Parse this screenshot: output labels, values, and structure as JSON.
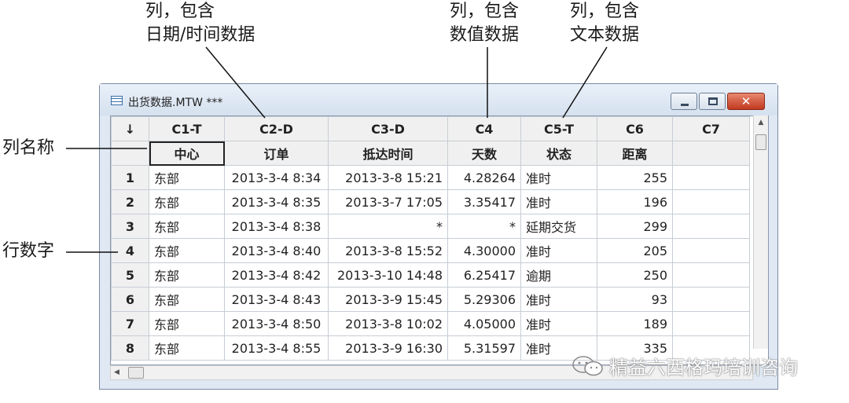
{
  "annotations": {
    "date_col_line1": "列，包含",
    "date_col_line2": "日期/时间数据",
    "num_col_line1": "列，包含",
    "num_col_line2": "数值数据",
    "text_col_line1": "列，包含",
    "text_col_line2": "文本数据",
    "col_name": "列名称",
    "row_number": "行数字"
  },
  "window": {
    "title": "出货数据.MTW ***",
    "close_glyph": "✕"
  },
  "sheet": {
    "corner": "↓",
    "headers": [
      "C1-T",
      "C2-D",
      "C3-D",
      "C4",
      "C5-T",
      "C6",
      "C7"
    ],
    "names": [
      "中心",
      "订单",
      "抵达时间",
      "天数",
      "状态",
      "距离",
      ""
    ],
    "rows": [
      {
        "n": "1",
        "c1": "东部",
        "c2": "2013-3-4 8:34",
        "c3": "2013-3-8 15:21",
        "c4": "4.28264",
        "c5": "准时",
        "c6": "255",
        "c7": ""
      },
      {
        "n": "2",
        "c1": "东部",
        "c2": "2013-3-4 8:35",
        "c3": "2013-3-7 17:05",
        "c4": "3.35417",
        "c5": "准时",
        "c6": "196",
        "c7": ""
      },
      {
        "n": "3",
        "c1": "东部",
        "c2": "2013-3-4 8:38",
        "c3": "*",
        "c4": "*",
        "c5": "延期交货",
        "c6": "299",
        "c7": ""
      },
      {
        "n": "4",
        "c1": "东部",
        "c2": "2013-3-4 8:40",
        "c3": "2013-3-8 15:52",
        "c4": "4.30000",
        "c5": "准时",
        "c6": "205",
        "c7": ""
      },
      {
        "n": "5",
        "c1": "东部",
        "c2": "2013-3-4 8:42",
        "c3": "2013-3-10 14:48",
        "c4": "6.25417",
        "c5": "逾期",
        "c6": "250",
        "c7": ""
      },
      {
        "n": "6",
        "c1": "东部",
        "c2": "2013-3-4 8:43",
        "c3": "2013-3-9 15:45",
        "c4": "5.29306",
        "c5": "准时",
        "c6": "93",
        "c7": ""
      },
      {
        "n": "7",
        "c1": "东部",
        "c2": "2013-3-4 8:50",
        "c3": "2013-3-8 10:02",
        "c4": "4.05000",
        "c5": "准时",
        "c6": "189",
        "c7": ""
      },
      {
        "n": "8",
        "c1": "东部",
        "c2": "2013-3-4 8:55",
        "c3": "2013-3-9 16:30",
        "c4": "5.31597",
        "c5": "准时",
        "c6": "335",
        "c7": ""
      }
    ]
  },
  "watermark": "精益六西格玛培训咨询",
  "icons": [
    "worksheet-icon",
    "minimize-icon",
    "maximize-icon",
    "close-icon",
    "scroll-up-icon",
    "scroll-left-icon",
    "wechat-logo-icon"
  ]
}
